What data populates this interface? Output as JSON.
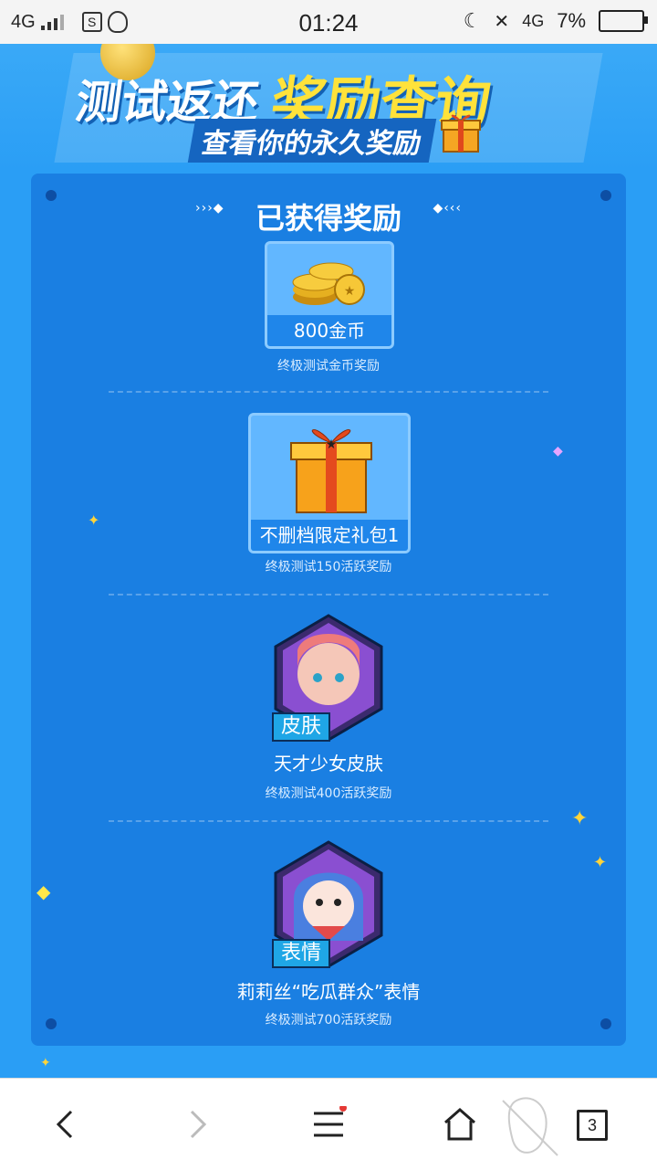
{
  "status_bar": {
    "network_left": "4G",
    "time": "01:24",
    "network_right": "4G",
    "battery_percent": "7%"
  },
  "banner": {
    "title_part1": "测试返还",
    "title_part2": "奖励查询",
    "subtitle": "查看你的永久奖励"
  },
  "panel": {
    "title": "已获得奖励",
    "rewards": [
      {
        "name": "800金币",
        "caption": "终极测试金币奖励",
        "icon": "coins-icon"
      },
      {
        "name": "不删档限定礼包1",
        "caption": "终极测试150活跃奖励",
        "icon": "gift-box-icon"
      },
      {
        "name": "天才少女皮肤",
        "caption": "终极测试400活跃奖励",
        "badge": "皮肤",
        "icon": "character-portrait-icon"
      },
      {
        "name": "莉莉丝“吃瓜群众”表情",
        "caption": "终极测试700活跃奖励",
        "badge": "表情",
        "icon": "emoji-portrait-icon"
      }
    ]
  },
  "browser_nav": {
    "tab_count": "3",
    "back_icon": "chevron-left-icon",
    "forward_icon": "chevron-right-icon",
    "menu_icon": "hamburger-menu-icon",
    "home_icon": "home-icon",
    "tabs_icon": "tabs-count-icon"
  },
  "colors": {
    "background": "#2a9ef5",
    "panel": "#1a7fe2",
    "accent_yellow": "#ffe23a"
  }
}
